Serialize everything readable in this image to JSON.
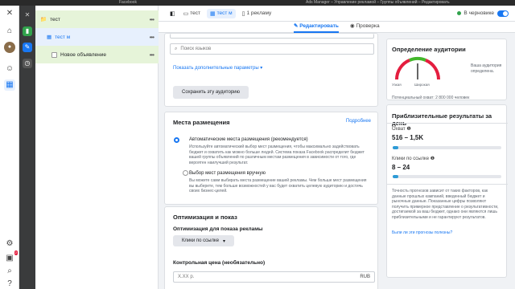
{
  "mac_bar": {
    "left": "Facebook",
    "center": "Ads Manager – Управление рекламой – Группы объявлений – Редактировать"
  },
  "tree": {
    "campaign": "тест",
    "adset": "тест м",
    "ad": "Новое объявление",
    "more": "•••"
  },
  "topbar": {
    "crumb1": "тест",
    "crumb2": "тест м",
    "crumb3": "1 рекламу",
    "draft_status": "В черновике"
  },
  "subtabs": {
    "edit": "Редактировать",
    "review": "Проверка"
  },
  "audience": {
    "language_placeholder": "Поиск языков",
    "more_params_link": "Показать дополнительные параметры ▾",
    "save_button": "Сохранить эту аудиторию"
  },
  "placements": {
    "title": "Места размещения",
    "more_link": "Подробнее",
    "auto_label": "Автоматические места размещения (рекомендуется)",
    "auto_desc": "Используйте автоматический выбор мест размещения, чтобы максимально задействовать бюджет и охватить как можно больше людей. Система показа Facebook распределит бюджет вашей группы объявлений по различным местам размещения в зависимости от того, где вероятен наилучший результат.",
    "manual_label": "Выбор мест размещения вручную",
    "manual_desc": "Вы можете сами выбирать места размещение вашей рекламы. Чем больше мест размещения вы выберете, тем больше возможностей у вас будет охватить целевую аудиторию и достичь своих бизнес-целей."
  },
  "optimization": {
    "title": "Оптимизация и показ",
    "for_ad_label": "Оптимизация для показа рекламы",
    "dropdown": "Клики по ссылке",
    "bid_label": "Контрольная цена (необязательно)",
    "bid_placeholder": "X.XX р.",
    "currency": "RUB"
  },
  "audience_definition": {
    "title": "Определение аудитории",
    "narrow": "Узкая",
    "broad": "Широкая",
    "status": "Ваша аудитория определена.",
    "potential_reach": "Потенциальный охват: 2 800 000 человек",
    "gauge_level": 0.5
  },
  "estimated_results": {
    "title": "Приблизительные результаты за день",
    "reach_label": "Охват",
    "reach_value": "516 – 1,5K",
    "reach_fill": 0.05,
    "clicks_label": "Клики по ссылке",
    "clicks_value": "8 – 24",
    "clicks_fill": 0.05,
    "disclaimer": "Точность прогнозов зависит от таких факторов, как данные прошлых кампаний, введенный бюджет и рыночные данные. Показанные цифры позволяют получить примерное представление о результативности, достигаемой за ваш бюджет, однако они являются лишь приблизительными и не гарантируют результатов.",
    "feedback_link": "Были ли эти прогнозы полезны?"
  },
  "colors": {
    "accent": "#1877f2",
    "campaign_row": "#e6f4d9",
    "adset_row": "#e7f0fd",
    "result_bar": "#2e9bd6"
  }
}
